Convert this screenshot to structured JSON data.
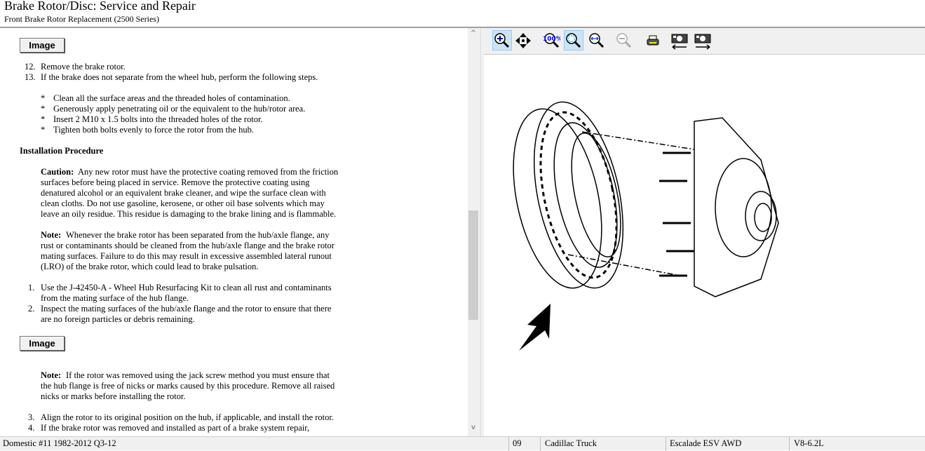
{
  "header": {
    "title": "Brake Rotor/Disc:  Service and Repair",
    "subtitle": "Front Brake Rotor Replacement (2500 Series)"
  },
  "document": {
    "image_button_label": "Image",
    "steps_a": [
      {
        "num": "12.",
        "text": "Remove the brake rotor."
      },
      {
        "num": "13.",
        "text": "If the brake does not separate from the wheel hub, perform the following steps."
      }
    ],
    "bullets": [
      "Clean all the surface areas and the threaded holes of contamination.",
      "Generously apply penetrating oil or the equivalent to the hub/rotor area.",
      "Insert 2 M10 x 1.5 bolts into the threaded holes of the rotor.",
      "Tighten both bolts evenly to force the rotor from the hub."
    ],
    "bullet_char": "*",
    "install_heading": "Installation Procedure",
    "caution_label": "Caution:",
    "caution_lines": [
      "Any new rotor must have the protective coating removed from the friction",
      "surfaces before being placed in service. Remove the protective coating using",
      "denatured alcohol or an equivalent brake cleaner, and wipe the surface clean with",
      "clean cloths. Do not use gasoline, kerosene, or other oil base solvents which may",
      "leave an oily residue. This residue is damaging to the brake lining and is flammable."
    ],
    "note1_label": "Note:",
    "note1_lines": [
      "Whenever the brake rotor has been separated from the hub/axle flange, any",
      "rust or contaminants should be cleaned from the hub/axle flange and the brake rotor",
      "mating surfaces. Failure to do this may result in excessive assembled lateral runout",
      "(LRO) of the brake rotor, which could lead to brake pulsation."
    ],
    "steps_b": [
      {
        "num": "1.",
        "lines": [
          "Use the J-42450-A - Wheel Hub Resurfacing Kit to clean all rust and contaminants",
          "from the mating surface of the hub flange."
        ]
      },
      {
        "num": "2.",
        "lines": [
          "Inspect the mating surfaces of the hub/axle flange and the rotor to ensure that there",
          "are no foreign particles or debris remaining."
        ]
      }
    ],
    "note2_label": "Note:",
    "note2_lines": [
      "If the rotor was removed using the jack screw method you must ensure that",
      "the hub flange is free of nicks or marks caused by this procedure. Remove all raised",
      "nicks or marks before installing the rotor."
    ],
    "steps_c": [
      {
        "num": "3.",
        "text": "Align the rotor to its original position on the hub, if applicable, and install the rotor."
      },
      {
        "num": "4.",
        "text": "If the brake rotor was removed and installed as part of a brake system repair,"
      }
    ]
  },
  "toolbar": {
    "icons": [
      "zoom-in-icon",
      "pan-icon",
      "zoom-100-icon",
      "zoom-fit-icon",
      "zoom-width-icon",
      "zoom-out-icon",
      "print-icon",
      "previous-image-icon",
      "next-image-icon"
    ]
  },
  "status": {
    "database": "Domestic #11 1982-2012 Q3-12",
    "year": "09",
    "make": "Cadillac Truck",
    "model": "Escalade ESV AWD",
    "engine": "V8-6.2L"
  }
}
